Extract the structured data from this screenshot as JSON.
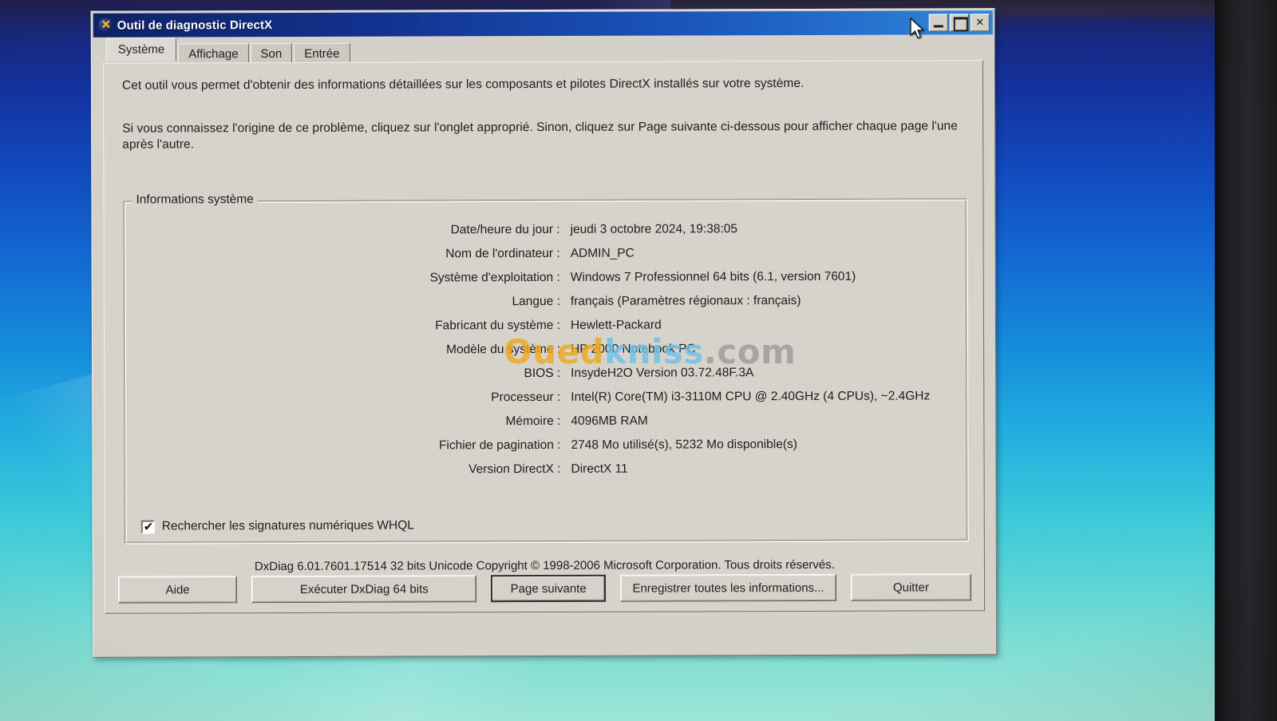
{
  "window": {
    "title": "Outil de diagnostic DirectX",
    "icon": "directx-icon",
    "controls": {
      "minimize": "_",
      "maximize": "□",
      "close": "✕"
    }
  },
  "tabs": [
    {
      "label": "Système",
      "active": true
    },
    {
      "label": "Affichage",
      "active": false
    },
    {
      "label": "Son",
      "active": false
    },
    {
      "label": "Entrée",
      "active": false
    }
  ],
  "intro": {
    "line1": "Cet outil vous permet d'obtenir des informations détaillées sur les composants et pilotes DirectX installés sur votre système.",
    "line2": "Si vous connaissez l'origine de ce problème, cliquez sur l'onglet approprié. Sinon, cliquez sur Page suivante ci-dessous pour afficher chaque page l'une après l'autre."
  },
  "groupbox": {
    "legend": "Informations système",
    "rows": [
      {
        "label": "Date/heure du jour :",
        "value": "jeudi 3 octobre 2024, 19:38:05"
      },
      {
        "label": "Nom de l'ordinateur :",
        "value": "ADMIN_PC"
      },
      {
        "label": "Système d'exploitation :",
        "value": "Windows 7 Professionnel 64 bits (6.1, version 7601)"
      },
      {
        "label": "Langue :",
        "value": "français (Paramètres régionaux : français)"
      },
      {
        "label": "Fabricant du système :",
        "value": "Hewlett-Packard"
      },
      {
        "label": "Modèle du système :",
        "value": "HP 2000 Notebook PC"
      },
      {
        "label": "BIOS :",
        "value": "InsydeH2O Version 03.72.48F.3A"
      },
      {
        "label": "Processeur :",
        "value": "Intel(R) Core(TM) i3-3110M CPU @ 2.40GHz (4 CPUs), ~2.4GHz"
      },
      {
        "label": "Mémoire :",
        "value": "4096MB RAM"
      },
      {
        "label": "Fichier de pagination :",
        "value": "2748 Mo utilisé(s), 5232 Mo disponible(s)"
      },
      {
        "label": "Version DirectX :",
        "value": "DirectX 11"
      }
    ],
    "whql": {
      "label": "Rechercher les signatures numériques WHQL",
      "checked": true,
      "check_glyph": "✔"
    }
  },
  "copyright": "DxDiag 6.01.7601.17514 32 bits Unicode Copyright © 1998-2006 Microsoft Corporation. Tous droits réservés.",
  "buttons": [
    {
      "label": "Aide",
      "focused": false
    },
    {
      "label": "Exécuter DxDiag 64 bits",
      "focused": false
    },
    {
      "label": "Page suivante",
      "focused": true
    },
    {
      "label": "Enregistrer toutes les informations...",
      "focused": false
    },
    {
      "label": "Quitter",
      "focused": false
    }
  ],
  "watermark": {
    "part1": "Oued",
    "part2": "kniss",
    "part3": ".com",
    "color1": "#f0a81e",
    "color2": "#6ec2e8",
    "color3": "#9b9b9b"
  },
  "desktop": {
    "wallpaper_top_color": "#1c1b4a",
    "wallpaper_mid_color": "#1391de",
    "wallpaper_bottom_color": "#9ee6d8",
    "bezel_color": "#1b1b1f"
  },
  "cursor": {
    "name": "mouse-pointer"
  }
}
